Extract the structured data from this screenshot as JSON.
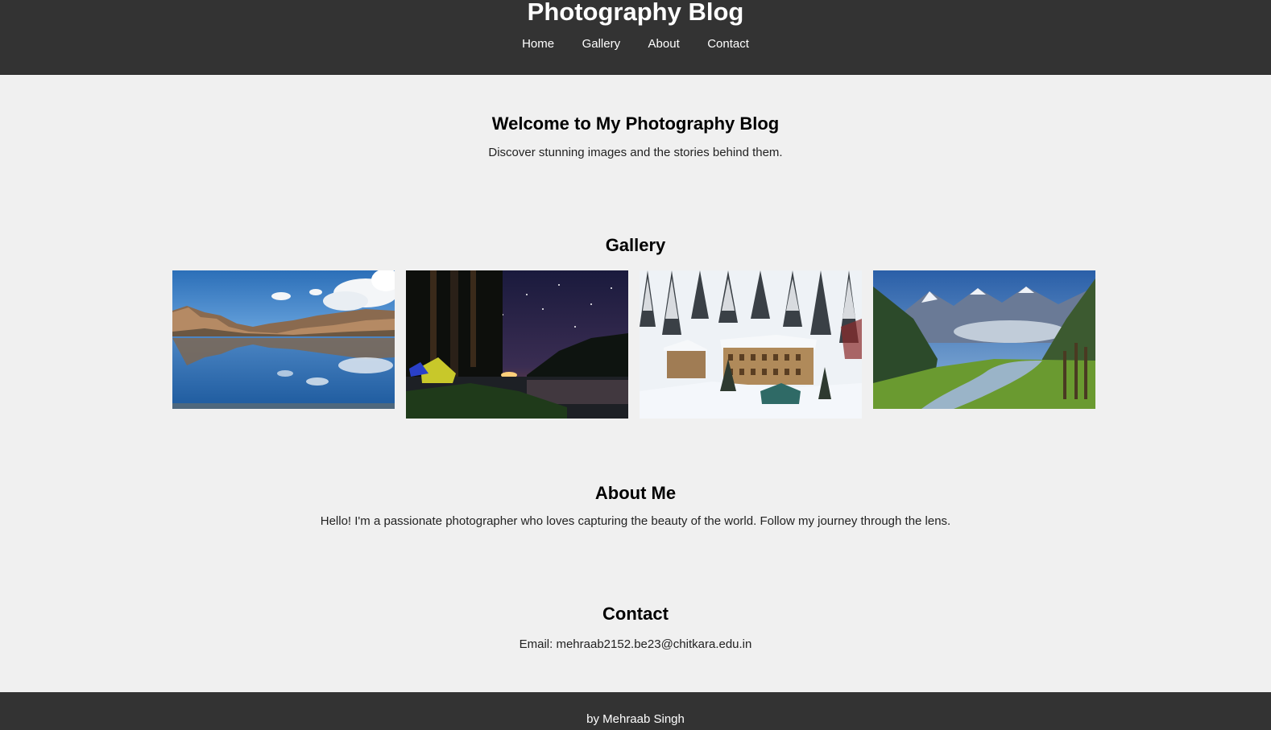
{
  "header": {
    "title": "Photography Blog",
    "nav": [
      "Home",
      "Gallery",
      "About",
      "Contact"
    ]
  },
  "welcome": {
    "heading": "Welcome to My Photography Blog",
    "text": "Discover stunning images and the stories behind them."
  },
  "gallery": {
    "heading": "Gallery",
    "photos": [
      "mountain-lake-reflection",
      "night-camping-lake",
      "snowy-hotel-forest",
      "green-valley-river"
    ]
  },
  "about": {
    "heading": "About Me",
    "text": "Hello! I'm a passionate photographer who loves capturing the beauty of the world. Follow my journey through the lens."
  },
  "contact": {
    "heading": "Contact",
    "email": "Email: mehraab2152.be23@chitkara.edu.in"
  },
  "footer": {
    "text": "by Mehraab Singh"
  },
  "colors": {
    "header_bg": "#333333",
    "page_bg": "#f0f0f0",
    "header_text": "#ffffff"
  }
}
